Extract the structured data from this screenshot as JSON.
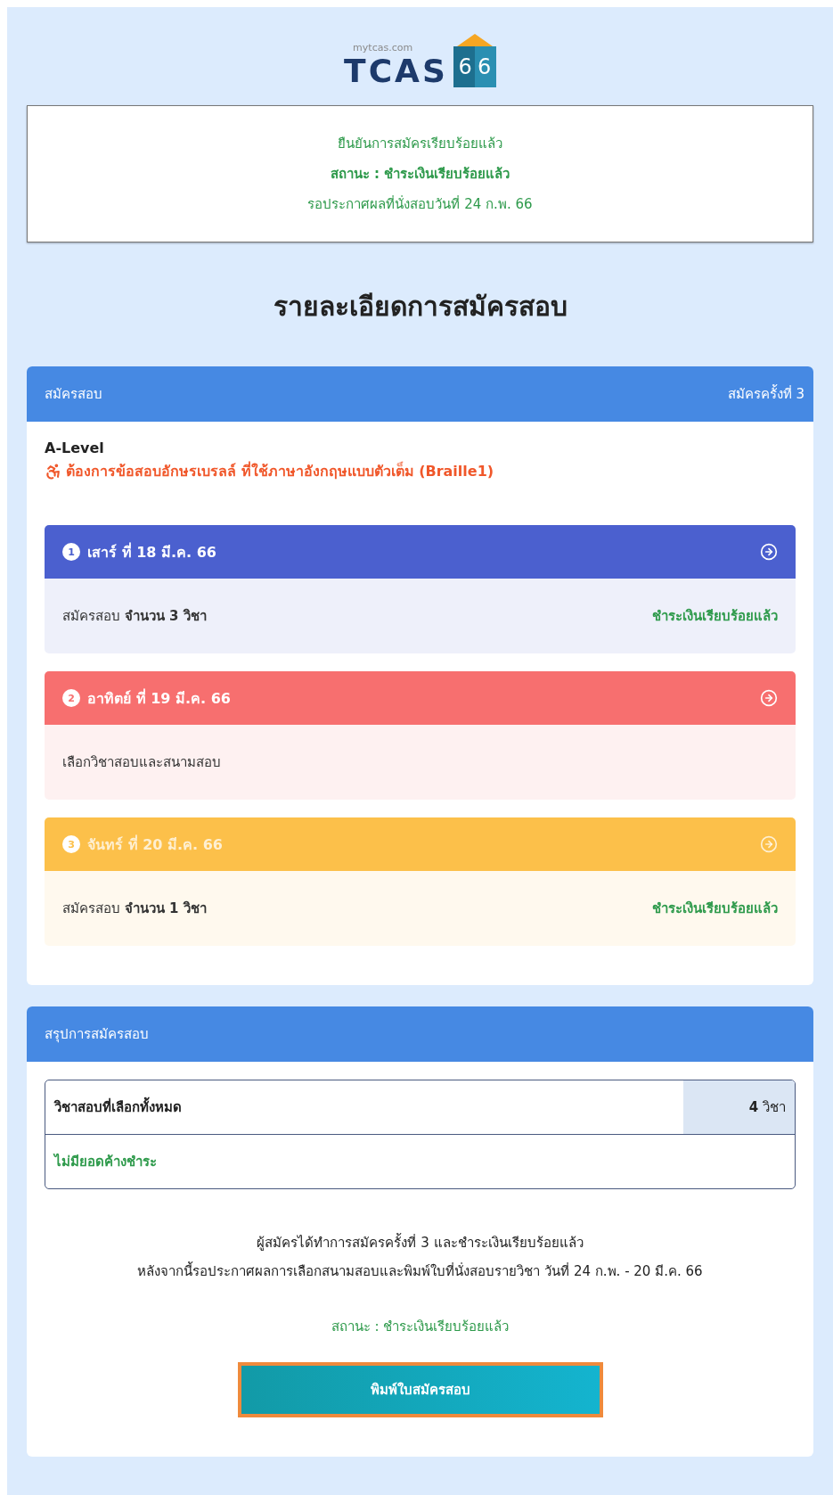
{
  "logo": {
    "site": "mytcas.com",
    "name": "TCAS",
    "year": "66"
  },
  "status_box": {
    "lines": [
      {
        "text": "ยืนยันการสมัครเรียบร้อยแล้ว",
        "bold": false
      },
      {
        "text": "สถานะ : ชำระเงินเรียบร้อยแล้ว",
        "bold": true
      },
      {
        "text": "รอประกาศผลที่นั่งสอบวันที่ 24 ก.พ. 66",
        "bold": false
      }
    ]
  },
  "page_title": "รายละเอียดการสมัครสอบ",
  "application_card": {
    "title": "สมัครสอบ",
    "round": "สมัครครั้งที่ 3",
    "exam": "A-Level",
    "accommodation": "ต้องการข้อสอบอักษรเบรลล์ ที่ใช้ภาษาอังกฤษแบบตัวเต็ม (Braille1)",
    "days": [
      {
        "number": "1",
        "date": "เสาร์ ที่ 18 มี.ค. 66",
        "color": "#4b60cf",
        "faded": false,
        "detail": "สมัครสอบ **จำนวน 3 วิชา**",
        "status": "ชำระเงินเรียบร้อยแล้ว"
      },
      {
        "number": "2",
        "date": "อาทิตย์ ที่ 19 มี.ค. 66",
        "color": "#f76f6f",
        "faded": false,
        "detail": "เลือกวิชาสอบและสนามสอบ"
      },
      {
        "number": "3",
        "date": "จันทร์ ที่ 20 มี.ค. 66",
        "color": "#fcc04a",
        "faded": true,
        "detail": "สมัครสอบ **จำนวน 1 วิชา**",
        "status": "ชำระเงินเรียบร้อยแล้ว"
      }
    ]
  },
  "summary_card": {
    "title": "สรุปการสมัครสอบ",
    "total_label": "วิชาสอบที่เลือกทั้งหมด",
    "total_value": "**4** วิชา",
    "balance": "ไม่มียอดค้างชำระ",
    "message_lines": [
      "ผู้สมัครได้ทำการสมัครครั้งที่ 3 และชำระเงินเรียบร้อยแล้ว",
      "หลังจากนี้รอประกาศผลการเลือกสนามสอบและพิมพ์ใบที่นั่งสอบรายวิชา วันที่ 24 ก.พ. - 20 มี.ค. 66"
    ],
    "status": "สถานะ : ชำระเงินเรียบร้อยแล้ว",
    "print_button": "พิมพ์ใบสมัครสอบ"
  }
}
